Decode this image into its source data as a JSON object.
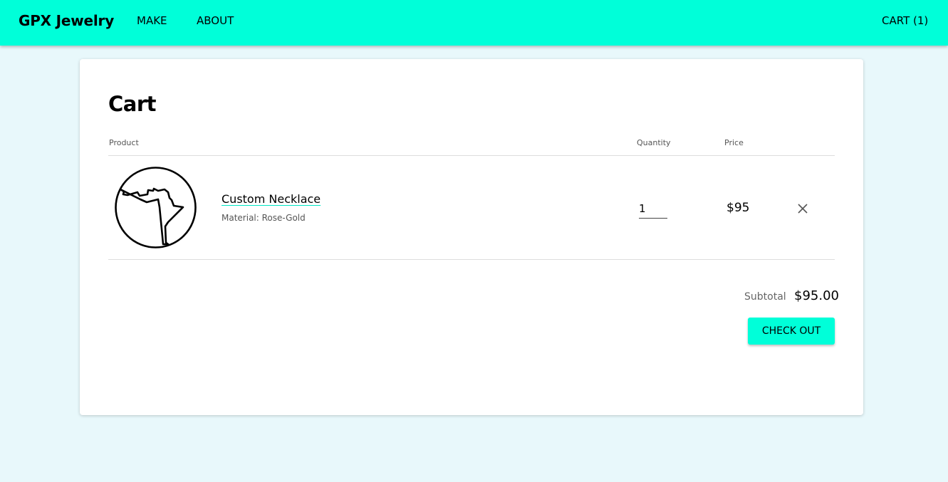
{
  "header": {
    "brand": "GPX Jewelry",
    "nav": {
      "make": "MAKE",
      "about": "ABOUT",
      "cart": "CART (1)"
    }
  },
  "cart": {
    "title": "Cart",
    "columns": {
      "product": "Product",
      "quantity": "Quantity",
      "price": "Price"
    },
    "items": [
      {
        "name": "Custom Necklace",
        "material": "Material: Rose-Gold",
        "quantity": "1",
        "price": "$95",
        "thumbnail_icon": "necklace-outline-icon",
        "remove_icon": "close-icon"
      }
    ],
    "subtotal_label": "Subtotal",
    "subtotal_value": "$95.00",
    "checkout_label": "CHECK OUT"
  },
  "colors": {
    "accent": "#00ffd9",
    "page_background": "#e8f8fb",
    "card_background": "#ffffff"
  }
}
